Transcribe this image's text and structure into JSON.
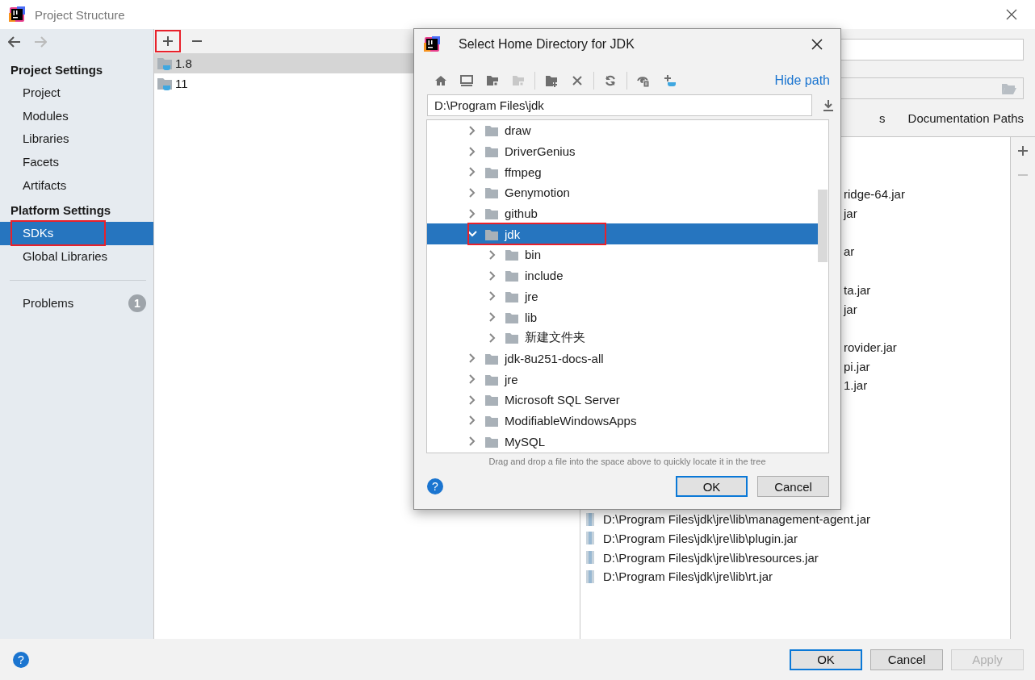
{
  "window": {
    "title": "Project Structure"
  },
  "help_button": "?",
  "nav": {
    "back_enabled": true,
    "forward_enabled": false
  },
  "sidebar": {
    "sections": [
      {
        "heading": "Project Settings",
        "items": [
          {
            "label": "Project",
            "selected": false,
            "highlighted": false
          },
          {
            "label": "Modules",
            "selected": false,
            "highlighted": false
          },
          {
            "label": "Libraries",
            "selected": false,
            "highlighted": false
          },
          {
            "label": "Facets",
            "selected": false,
            "highlighted": false
          },
          {
            "label": "Artifacts",
            "selected": false,
            "highlighted": false
          }
        ]
      },
      {
        "heading": "Platform Settings",
        "items": [
          {
            "label": "SDKs",
            "selected": true,
            "highlighted": true
          },
          {
            "label": "Global Libraries",
            "selected": false,
            "highlighted": false
          }
        ]
      }
    ],
    "problems": {
      "label": "Problems",
      "count": "1"
    }
  },
  "sdk_list": {
    "toolbar": [
      {
        "kind": "add",
        "highlighted": true
      },
      {
        "kind": "remove",
        "highlighted": false
      }
    ],
    "items": [
      {
        "name": "1.8",
        "selected": true
      },
      {
        "name": "11",
        "selected": false
      }
    ]
  },
  "sdk_details": {
    "tabs": [
      {
        "label": "s"
      },
      {
        "label": "Documentation Paths"
      }
    ],
    "classpath_tails": [
      "ridge-64.jar",
      "jar",
      "ar",
      "ta.jar",
      "jar",
      "rovider.jar",
      "pi.jar",
      "1.jar"
    ],
    "classpath": [
      "D:\\Program Files\\jdk\\jre\\lib\\management-agent.jar",
      "D:\\Program Files\\jdk\\jre\\lib\\plugin.jar",
      "D:\\Program Files\\jdk\\jre\\lib\\resources.jar",
      "D:\\Program Files\\jdk\\jre\\lib\\rt.jar"
    ],
    "side_toolbar": [
      {
        "kind": "add",
        "disabled": false
      },
      {
        "kind": "remove",
        "disabled": true
      }
    ]
  },
  "dialog": {
    "title": "Select Home Directory for JDK",
    "toolbar": [
      {
        "kind": "home",
        "disabled": false
      },
      {
        "kind": "desktop",
        "disabled": false
      },
      {
        "kind": "module-folder",
        "disabled": false
      },
      {
        "kind": "module-folder",
        "disabled": true
      },
      {
        "kind": "separator"
      },
      {
        "kind": "new-folder",
        "disabled": false
      },
      {
        "kind": "delete",
        "disabled": false
      },
      {
        "kind": "separator"
      },
      {
        "kind": "refresh",
        "disabled": false
      },
      {
        "kind": "separator"
      },
      {
        "kind": "show-hidden",
        "disabled": false
      },
      {
        "kind": "add-jdk",
        "disabled": false
      }
    ],
    "hide_path_link": "Hide path",
    "path": "D:\\Program Files\\jdk",
    "tree": [
      {
        "name": "draw",
        "expanded": false,
        "selected": false,
        "highlighted": false
      },
      {
        "name": "DriverGenius",
        "expanded": false,
        "selected": false,
        "highlighted": false
      },
      {
        "name": "ffmpeg",
        "expanded": false,
        "selected": false,
        "highlighted": false
      },
      {
        "name": "Genymotion",
        "expanded": false,
        "selected": false,
        "highlighted": false
      },
      {
        "name": "github",
        "expanded": false,
        "selected": false,
        "highlighted": false
      },
      {
        "name": "jdk",
        "expanded": true,
        "selected": true,
        "highlighted": true,
        "children": [
          {
            "name": "bin",
            "expanded": false,
            "selected": false,
            "highlighted": false
          },
          {
            "name": "include",
            "expanded": false,
            "selected": false,
            "highlighted": false
          },
          {
            "name": "jre",
            "expanded": false,
            "selected": false,
            "highlighted": false
          },
          {
            "name": "lib",
            "expanded": false,
            "selected": false,
            "highlighted": false
          },
          {
            "name": "新建文件夹",
            "expanded": false,
            "selected": false,
            "highlighted": false
          }
        ]
      },
      {
        "name": "jdk-8u251-docs-all",
        "expanded": false,
        "selected": false,
        "highlighted": false
      },
      {
        "name": "jre",
        "expanded": false,
        "selected": false,
        "highlighted": false
      },
      {
        "name": "Microsoft SQL Server",
        "expanded": false,
        "selected": false,
        "highlighted": false
      },
      {
        "name": "ModifiableWindowsApps",
        "expanded": false,
        "selected": false,
        "highlighted": false
      },
      {
        "name": "MySQL",
        "expanded": false,
        "selected": false,
        "highlighted": false
      }
    ],
    "hint": "Drag and drop a file into the space above to quickly locate it in the tree",
    "help_button": "?",
    "buttons": [
      {
        "label": "OK",
        "default": true,
        "disabled": false
      },
      {
        "label": "Cancel",
        "default": false,
        "disabled": false
      }
    ]
  },
  "buttons": [
    {
      "label": "OK",
      "default": true,
      "disabled": false
    },
    {
      "label": "Cancel",
      "default": false,
      "disabled": false
    },
    {
      "label": "Apply",
      "default": false,
      "disabled": true
    }
  ]
}
